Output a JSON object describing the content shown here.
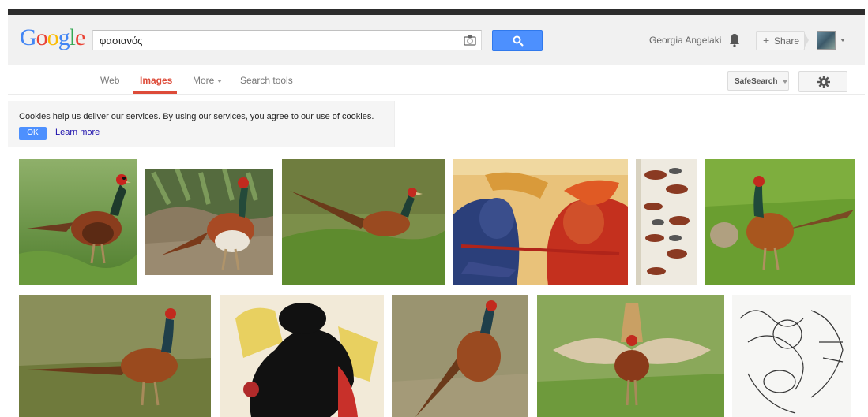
{
  "logo": {
    "letters": [
      "G",
      "o",
      "o",
      "g",
      "l",
      "e"
    ],
    "colors": [
      "#4285f4",
      "#ea4335",
      "#fbbc05",
      "#4285f4",
      "#34a853",
      "#ea4335"
    ]
  },
  "search": {
    "query": "φασιανός"
  },
  "header": {
    "user_name": "Georgia Angelaki",
    "share_label": "Share",
    "share_plus": "+"
  },
  "nav": {
    "tabs": [
      {
        "label": "Web"
      },
      {
        "label": "Images"
      },
      {
        "label": "More"
      },
      {
        "label": "Search tools"
      }
    ],
    "safesearch_label": "SafeSearch"
  },
  "cookie": {
    "message": "Cookies help us deliver our services. By using our services, you agree to our use of cookies.",
    "ok_label": "OK",
    "learn_more_label": "Learn more"
  },
  "colors": {
    "accent_blue": "#4d90fe",
    "active_tab_red": "#dd4b39",
    "link_blue": "#1a0dab"
  }
}
